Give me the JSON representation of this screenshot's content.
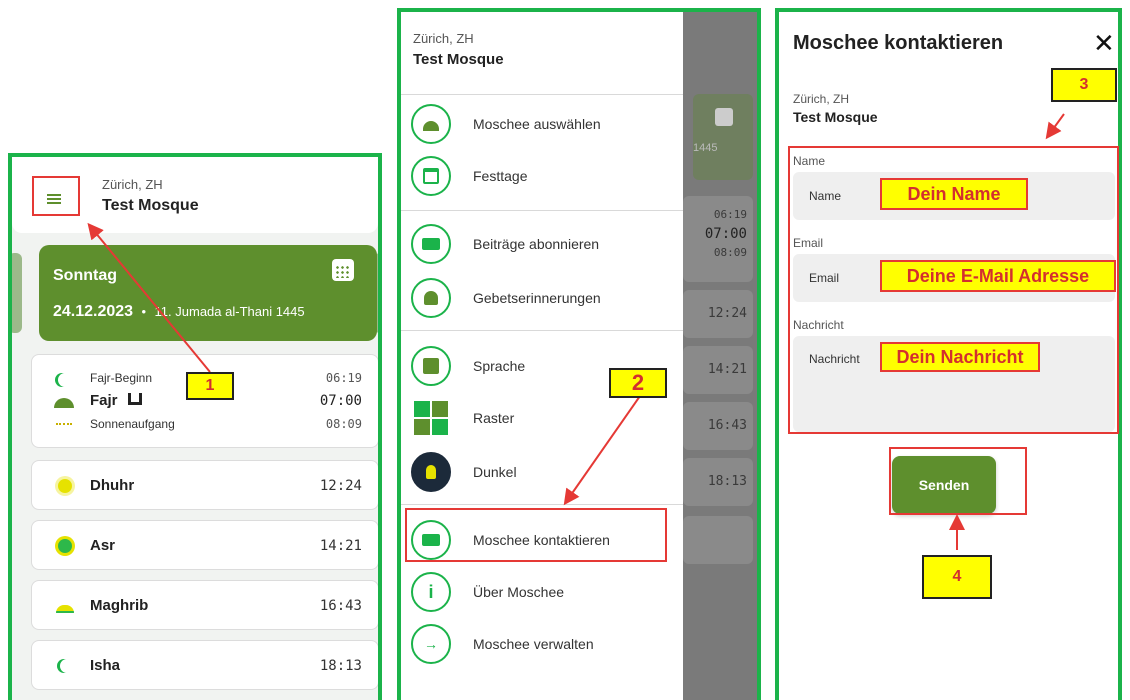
{
  "colors": {
    "frame": "#1bb34a",
    "accent_green": "#5e8f2d",
    "annotation_red": "#e53935",
    "annotation_yellow": "#ffff00"
  },
  "panel1": {
    "city": "Zürich, ZH",
    "mosque": "Test Mosque",
    "date_card": {
      "weekday": "Sonntag",
      "date": "24.12.2023",
      "separator": "•",
      "hijri": "11. Jumada al-Thani 1445",
      "icon": "calendar-icon"
    },
    "fajr_group": {
      "fajr_begin_label": "Fajr-Beginn",
      "fajr_begin_time": "06:19",
      "fajr_label": "Fajr",
      "fajr_icon": "mosque-icon",
      "fajr_time": "07:00",
      "sunrise_label": "Sonnenaufgang",
      "sunrise_time": "08:09"
    },
    "prayers": [
      {
        "name": "Dhuhr",
        "time": "12:24",
        "icon": "sun-icon"
      },
      {
        "name": "Asr",
        "time": "14:21",
        "icon": "sun-icon"
      },
      {
        "name": "Maghrib",
        "time": "16:43",
        "icon": "sunset-icon"
      },
      {
        "name": "Isha",
        "time": "18:13",
        "icon": "moon-icon"
      }
    ]
  },
  "panel2": {
    "city": "Zürich, ZH",
    "mosque": "Test Mosque",
    "menu": [
      {
        "label": "Moschee auswählen",
        "icon": "mosque-icon"
      },
      {
        "label": "Festtage",
        "icon": "calendar-icon"
      },
      {
        "label": "Beiträge abonnieren",
        "icon": "subscribe-icon"
      },
      {
        "label": "Gebetserinnerungen",
        "icon": "bell-icon"
      },
      {
        "label": "Sprache",
        "icon": "language-icon"
      },
      {
        "label": "Raster",
        "icon": "grid-icon"
      },
      {
        "label": "Dunkel",
        "icon": "lightbulb-icon"
      },
      {
        "label": "Moschee kontaktieren",
        "icon": "mail-icon"
      },
      {
        "label": "Über Moschee",
        "icon": "info-icon"
      },
      {
        "label": "Moschee verwalten",
        "icon": "login-icon"
      }
    ],
    "background": {
      "hijri_year": "1445",
      "times": [
        "06:19",
        "07:00",
        "08:09",
        "12:24",
        "14:21",
        "16:43",
        "18:13"
      ]
    }
  },
  "panel3": {
    "title": "Moschee kontaktieren",
    "close_icon": "close-icon",
    "city": "Zürich, ZH",
    "mosque": "Test Mosque",
    "name_label": "Name",
    "name_placeholder": "Name",
    "email_label": "Email",
    "email_placeholder": "Email",
    "message_label": "Nachricht",
    "message_placeholder": "Nachricht",
    "send_label": "Senden"
  },
  "annotations": {
    "step1": "1",
    "step2": "2",
    "step3": "3",
    "step4": "4",
    "name_hint": "Dein Name",
    "email_hint": "Deine E-Mail Adresse",
    "message_hint": "Dein Nachricht"
  }
}
